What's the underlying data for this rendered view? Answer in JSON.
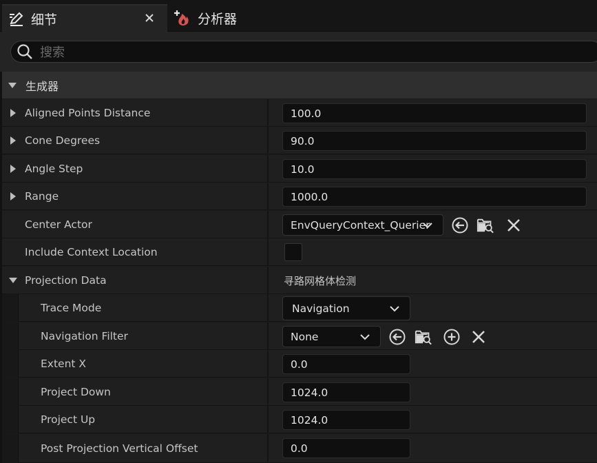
{
  "tabs": {
    "details_label": "细节",
    "profiler_label": "分析器",
    "close_glyph": "×"
  },
  "search": {
    "placeholder": "搜索"
  },
  "category": {
    "label": "生成器"
  },
  "properties": [
    {
      "name": "Aligned Points Distance",
      "value": "100.0"
    },
    {
      "name": "Cone Degrees",
      "value": "90.0"
    },
    {
      "name": "Angle Step",
      "value": "10.0"
    },
    {
      "name": "Range",
      "value": "1000.0"
    },
    {
      "name": "Center Actor",
      "value": "EnvQueryContext_Querier"
    },
    {
      "name": "Include Context Location",
      "value": ""
    },
    {
      "name": "Projection Data",
      "value": "寻路网格体检测"
    },
    {
      "name": "Trace Mode",
      "value": "Navigation"
    },
    {
      "name": "Navigation Filter",
      "value": "None"
    },
    {
      "name": "Extent X",
      "value": "0.0"
    },
    {
      "name": "Project Down",
      "value": "1024.0"
    },
    {
      "name": "Project Up",
      "value": "1024.0"
    },
    {
      "name": "Post Projection Vertical Offset",
      "value": "0.0"
    }
  ],
  "icons": {
    "details_tab": "edit-pencil-icon",
    "profiler_tab": "flame-plus-icon",
    "search": "search-icon",
    "use_selected": "arrow-left-circle-icon",
    "browse": "folder-search-icon",
    "add": "plus-circle-icon",
    "clear": "close-icon"
  },
  "colors": {
    "panel_bg": "#1f1f1f",
    "category_bg": "#2f2f2f",
    "field_bg": "#0f0f0f",
    "profiler_accent": "#e05a5a"
  }
}
